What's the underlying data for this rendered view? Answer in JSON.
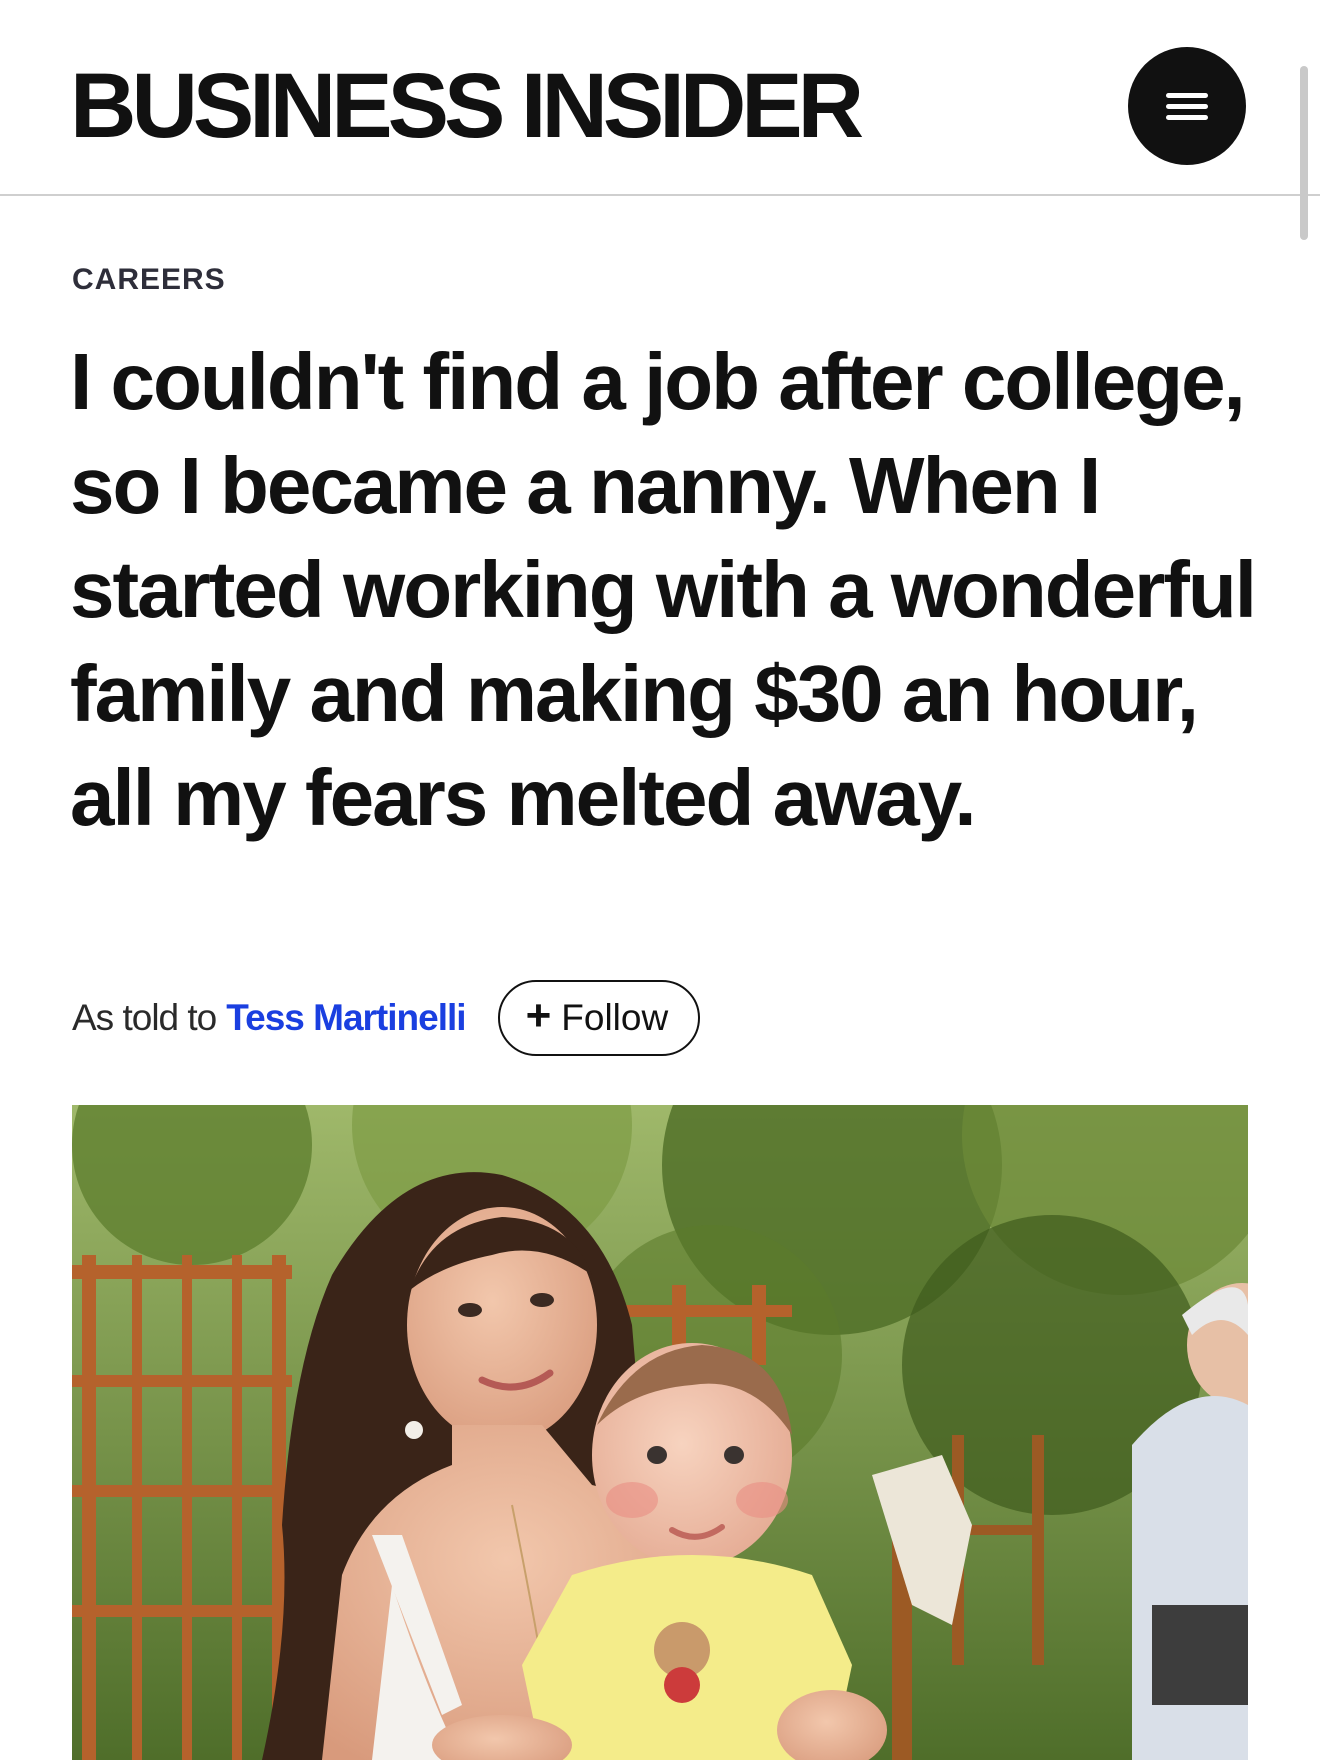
{
  "header": {
    "logo_text": "BUSINESS INSIDER",
    "menu_icon": "hamburger-menu-icon"
  },
  "article": {
    "category": "CAREERS",
    "headline": "I couldn't find a job after college, so I became a nanny. When I started working with a wonderful family and making $30 an hour, all my fears melted away.",
    "byline": {
      "prefix": "As told to",
      "author": "Tess Martinelli",
      "follow_label": "Follow",
      "follow_icon": "plus-icon"
    },
    "hero_image": {
      "alt": "Woman holding a baby outdoors"
    }
  },
  "colors": {
    "text": "#111111",
    "author_link": "#1a3fe0",
    "divider": "#cfcfcf"
  }
}
